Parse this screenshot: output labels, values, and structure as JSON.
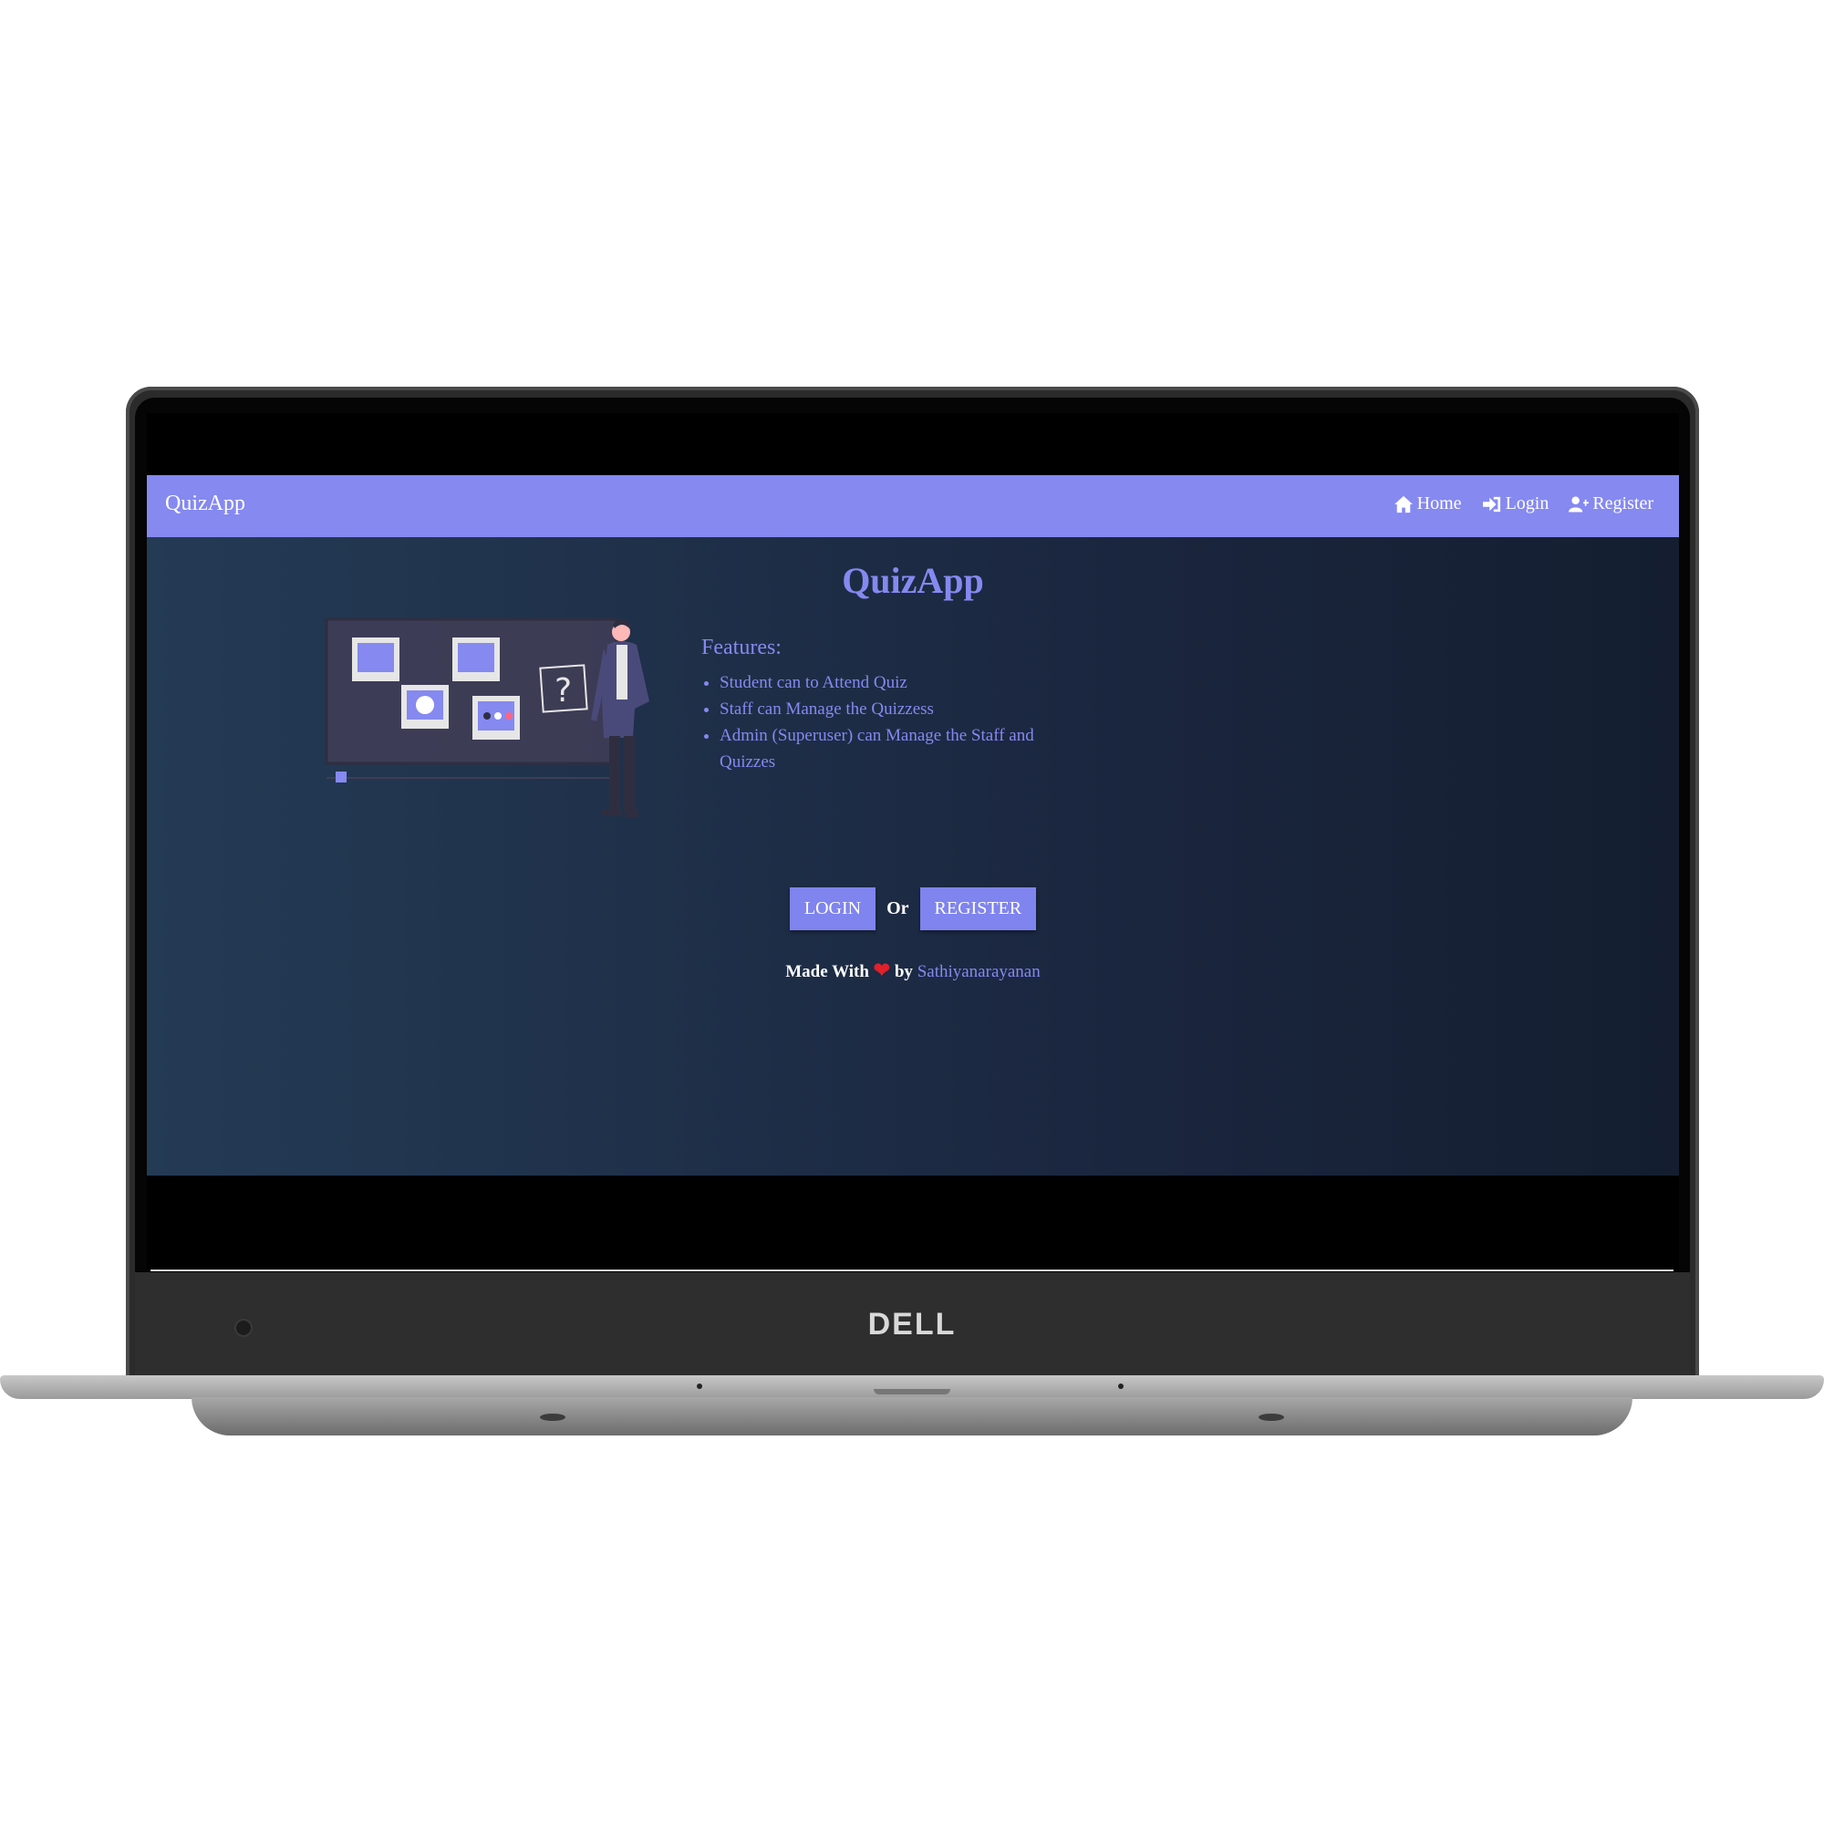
{
  "device": {
    "brand": "DELL"
  },
  "navbar": {
    "brand": "QuizApp",
    "links": [
      {
        "label": "Home",
        "icon": "home-icon"
      },
      {
        "label": "Login",
        "icon": "sign-in-icon"
      },
      {
        "label": "Register",
        "icon": "user-plus-icon"
      }
    ]
  },
  "main": {
    "title": "QuizApp",
    "features_title": "Features:",
    "features": [
      "Student can to Attend Quiz",
      "Staff can Manage the Quizzess",
      "Admin (Superuser) can Manage the Staff and Quizzes"
    ],
    "login_label": "LOGIN",
    "or_label": "Or",
    "register_label": "REGISTER"
  },
  "footer": {
    "made_with": "Made With",
    "heart": "❤",
    "by": "by",
    "author": "Sathiyanarayanan"
  },
  "colors": {
    "accent": "#8589f0",
    "background_start": "#243b55",
    "background_end": "#141e30",
    "heart": "#e0202a"
  }
}
